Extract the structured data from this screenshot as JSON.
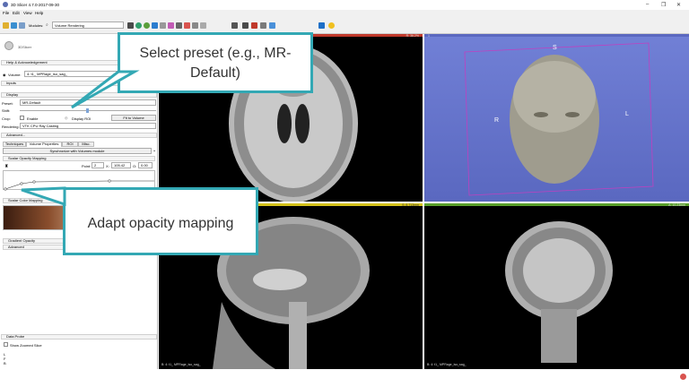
{
  "window": {
    "title": "3D Slicer 4.7.0-2017-09-30",
    "controls": {
      "minimize": "–",
      "maximize": "❐",
      "close": "✕"
    }
  },
  "menu": [
    "File",
    "Edit",
    "View",
    "Help"
  ],
  "toolbar": {
    "modules_label": "Modules:",
    "module_value": "Volume Rendering"
  },
  "panel": {
    "logo_label": "3DSlicer",
    "help_section": "Help & Acknowledgement",
    "volume_label": "Volume:",
    "volume_value": "4: t1_ MPRage_iso_sag_",
    "inputs_section": "Inputs",
    "display_section": "Display",
    "preset_label": "Preset:",
    "preset_value": "MR-Default",
    "shift_label": "Shift:",
    "crop_label": "Crop:",
    "enable_label": "Enable",
    "display_roi_label": "Display ROI",
    "fit_button": "Fit to Volume",
    "rendering_label": "Rendering:",
    "rendering_value": "VTK CPU Ray Casting",
    "advanced_section": "Advanced...",
    "tabs": [
      "Techniques",
      "Volume Properties",
      "ROI",
      "Misc."
    ],
    "sync_button": "Synchronize with Volumes module",
    "scalar_opacity_section": "Scalar Opacity Mapping",
    "point_label": "Point:",
    "point_value": "2",
    "x_label": "X:",
    "x_value": "105.42",
    "o_label": "O:",
    "o_value": "0.00",
    "scalar_color_section": "Scalar Color Mapping",
    "gradient_section": "Gradient Opacity",
    "advanced_sub": "Advanced",
    "data_probe_section": "Data Probe",
    "show_zoomed": "Show Zoomed Slice",
    "probe_l": "L",
    "probe_f": "F",
    "probe_b": "B"
  },
  "views": {
    "red_label": "R: 36.2%",
    "threed_label": "1",
    "yellow_label": "S: 8.713mm",
    "green_label": "A: 10.23mm",
    "yellow_footer": "B: 4: t1_ MPRage_iso_sag_",
    "green_footer": "B: 4: t1_ MPRage_iso_sag_",
    "orient_s": "S",
    "orient_r": "R",
    "orient_l": "L"
  },
  "callouts": {
    "preset": "Select preset (e.g., MR-Default)",
    "opacity": "Adapt opacity mapping"
  },
  "colors": {
    "accent": "#33a8b4",
    "red_view": "#c0392b",
    "yellow_view": "#d4c21a",
    "green_view": "#5aa02c",
    "threed_bg": "#6a7ad0"
  }
}
